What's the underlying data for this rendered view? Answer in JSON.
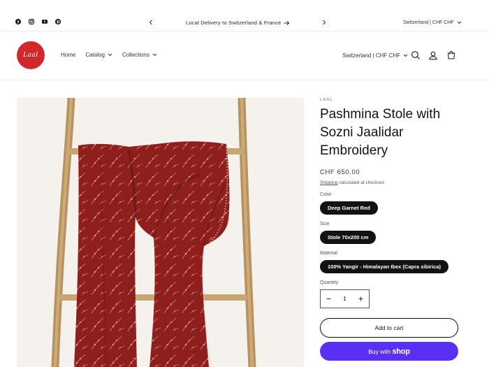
{
  "announcement": {
    "message": "Local Delivery to Switzerland & France",
    "country_selector": "Switzerland | CHF CHF"
  },
  "social_icons": [
    "facebook-icon",
    "instagram-icon",
    "youtube-icon",
    "pinterest-icon"
  ],
  "header": {
    "logo_text": "Laal",
    "nav": [
      {
        "label": "Home",
        "has_dropdown": false
      },
      {
        "label": "Catalog",
        "has_dropdown": true
      },
      {
        "label": "Collections",
        "has_dropdown": true
      }
    ],
    "country_selector": "Switzerland | CHF CHF",
    "icons": [
      "search-icon",
      "account-icon",
      "cart-icon"
    ]
  },
  "product": {
    "vendor": "LAAL",
    "title": "Pashmina Stole with Sozni Jaalidar Embroidery",
    "price": "CHF 650.00",
    "shipping_link": "Shipping",
    "tax_note": " calculated at checkout.",
    "options": [
      {
        "label": "Color",
        "value": "Deep Garnet Red"
      },
      {
        "label": "Size",
        "value": "Stole 70x200 cm"
      },
      {
        "label": "Material",
        "value": "100% Yangir - Himalayan Ibex (Capra sibirica)"
      }
    ],
    "quantity_label": "Quantity",
    "quantity": "1",
    "add_to_cart": "Add to cart",
    "buy_with": "Buy with",
    "buy_brand": "shop"
  },
  "colors": {
    "accent_logo": "#d0282d",
    "pill_bg": "#121212",
    "shop_pay": "#5a31f4",
    "stole": "#8e1f1c"
  }
}
